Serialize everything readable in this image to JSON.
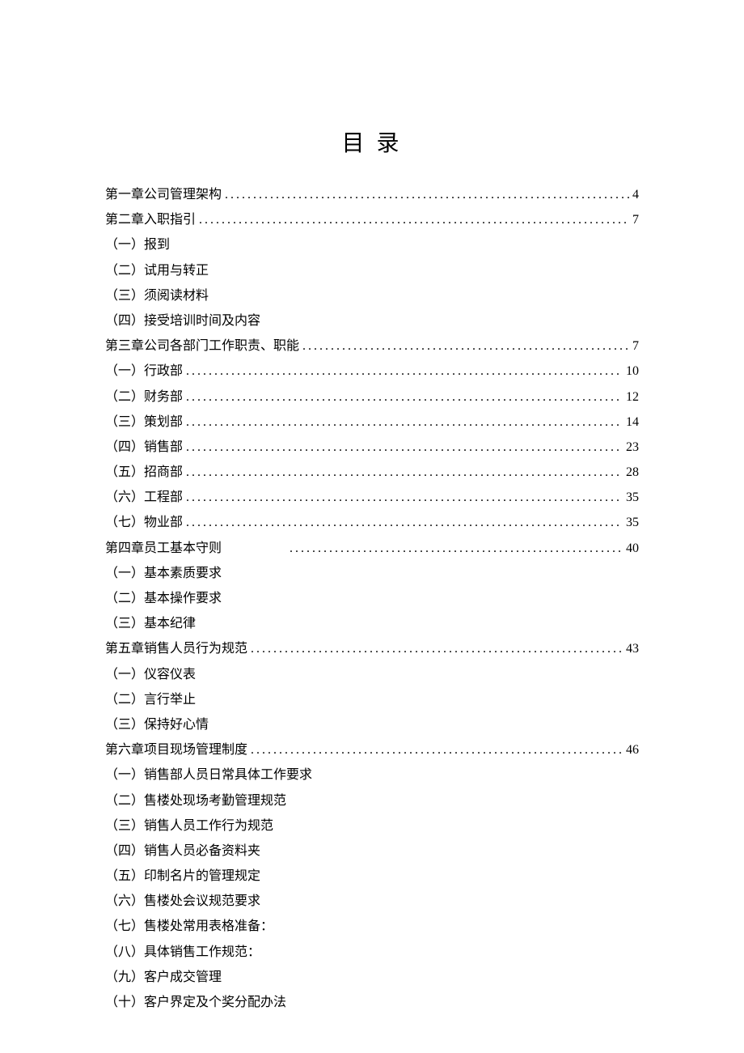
{
  "title": "目 录",
  "toc": [
    {
      "type": "chapter",
      "label": "第一章公司管理架构",
      "page": "4"
    },
    {
      "type": "chapter",
      "label": "第二章入职指引",
      "page": "7"
    },
    {
      "type": "sub",
      "label": "（一）报到"
    },
    {
      "type": "sub",
      "label": "（二）试用与转正"
    },
    {
      "type": "sub",
      "label": "（三）须阅读材料"
    },
    {
      "type": "sub",
      "label": "（四）接受培训时间及内容"
    },
    {
      "type": "chapter",
      "label": "第三章公司各部门工作职责、职能",
      "page": "7"
    },
    {
      "type": "subp",
      "label": "（一）行政部",
      "page": "10"
    },
    {
      "type": "subp",
      "label": "（二）财务部",
      "page": "12"
    },
    {
      "type": "subp",
      "label": "（三）策划部",
      "page": "14"
    },
    {
      "type": "subp",
      "label": "（四）销售部",
      "page": "23"
    },
    {
      "type": "subp",
      "label": "（五）招商部",
      "page": "28"
    },
    {
      "type": "subp",
      "label": "（六）工程部",
      "page": "35"
    },
    {
      "type": "subp",
      "label": "（七）物业部",
      "page": "35"
    },
    {
      "type": "chapter-gap",
      "label": "第四章员工基本守则",
      "page": "40"
    },
    {
      "type": "sub",
      "label": "（一）基本素质要求"
    },
    {
      "type": "sub",
      "label": "（二）基本操作要求"
    },
    {
      "type": "sub",
      "label": "（三）基本纪律"
    },
    {
      "type": "chapter",
      "label": "第五章销售人员行为规范",
      "page": "43"
    },
    {
      "type": "sub",
      "label": "（一）仪容仪表"
    },
    {
      "type": "sub",
      "label": "（二）言行举止"
    },
    {
      "type": "sub",
      "label": "（三）保持好心情"
    },
    {
      "type": "chapter",
      "label": "第六章项目现场管理制度",
      "page": "46"
    },
    {
      "type": "sub",
      "label": "（一）销售部人员日常具体工作要求"
    },
    {
      "type": "sub",
      "label": "（二）售楼处现场考勤管理规范"
    },
    {
      "type": "sub",
      "label": "（三）销售人员工作行为规范"
    },
    {
      "type": "sub",
      "label": "（四）销售人员必备资料夹"
    },
    {
      "type": "sub",
      "label": "（五）印制名片的管理规定"
    },
    {
      "type": "sub",
      "label": "（六）售楼处会议规范要求"
    },
    {
      "type": "sub",
      "label": "（七）售楼处常用表格准备："
    },
    {
      "type": "sub",
      "label": "（八）具体销售工作规范："
    },
    {
      "type": "sub",
      "label": "（九）客户成交管理"
    },
    {
      "type": "sub",
      "label": "（十）客户界定及个奖分配办法"
    }
  ]
}
